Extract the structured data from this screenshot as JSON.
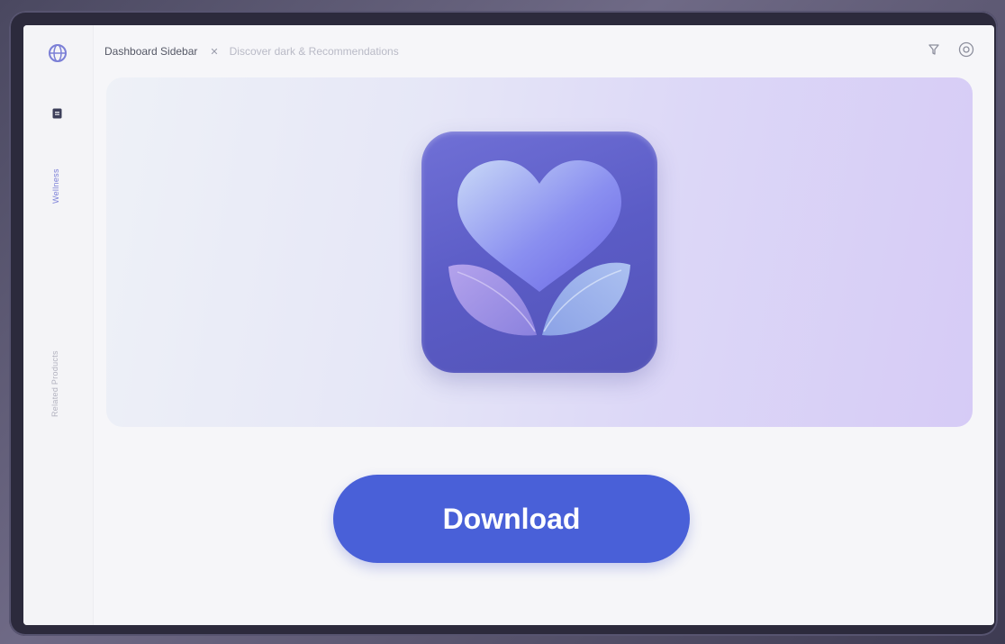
{
  "sidebar": {
    "logo_icon": "globe-icon",
    "doc_icon": "document-icon",
    "items": [
      {
        "label": "Wellness",
        "active": true
      },
      {
        "label": "Related Products",
        "active": false
      }
    ]
  },
  "header": {
    "tab_label": "Dashboard Sidebar",
    "close_glyph": "✕",
    "breadcrumb": "Discover dark & Recommendations"
  },
  "toolbar": {
    "icons": [
      "filter-icon",
      "settings-icon"
    ]
  },
  "hero": {
    "app_icon": "heart-leaves-icon"
  },
  "actions": {
    "download_label": "Download"
  },
  "colors": {
    "accent": "#4960d8",
    "icon_tile": "#5b5cc6",
    "sidebar_active": "#7c80d8"
  }
}
